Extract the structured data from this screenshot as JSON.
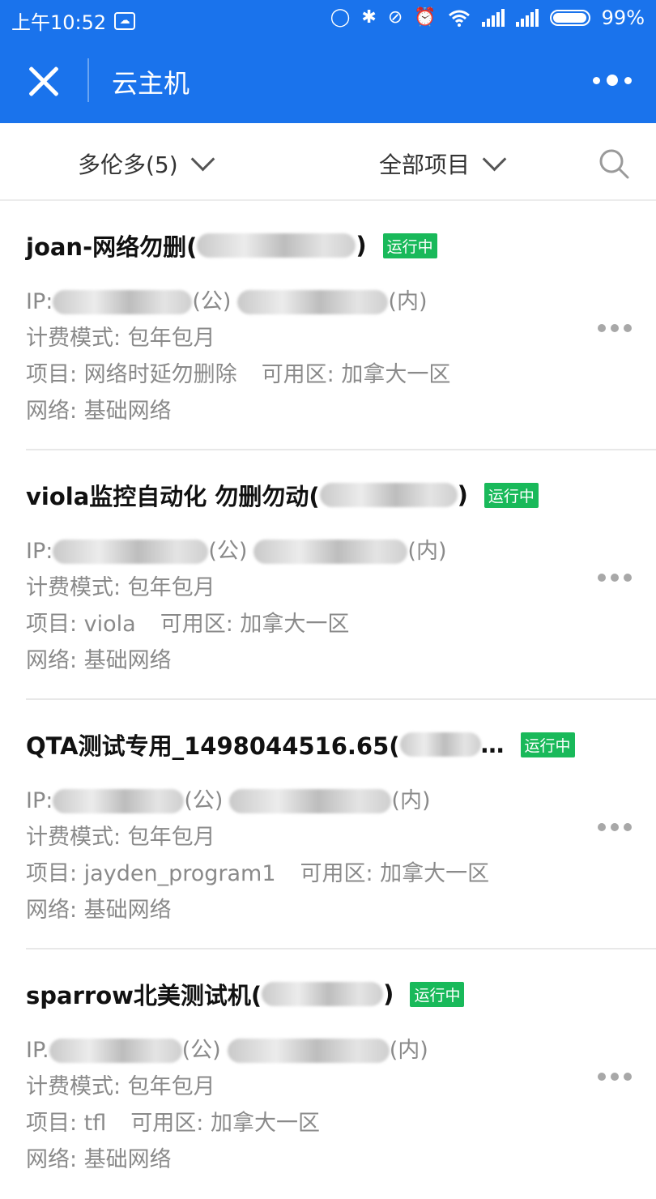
{
  "status_bar": {
    "time": "上午10:52",
    "battery_percent": "99%",
    "icons": [
      "cloud-icon",
      "sync-icon",
      "bluetooth-icon",
      "vibrate-off-icon",
      "alarm-icon",
      "wifi-icon",
      "signal-icon",
      "signal-icon",
      "battery-icon"
    ]
  },
  "app_bar": {
    "title": "云主机",
    "accent_color": "#1a73ec"
  },
  "filters": {
    "region": "多伦多(5)",
    "project": "全部项目"
  },
  "instances": [
    {
      "name": "joan-网络勿删(",
      "name_suffix": ")",
      "status": "运行中",
      "ip_label": "IP:",
      "public_tag": "(公)",
      "private_tag": "(内)",
      "billing": "计费模式: 包年包月",
      "project": "项目: 网络时延勿删除",
      "zone": "可用区: 加拿大一区",
      "network": "网络: 基础网络"
    },
    {
      "name": "viola监控自动化 勿删勿动(",
      "name_suffix": ")",
      "status": "运行中",
      "ip_label": "IP:",
      "public_tag": "(公)",
      "private_tag": "(内)",
      "billing": "计费模式: 包年包月",
      "project": "项目: viola",
      "zone": "可用区: 加拿大一区",
      "network": "网络: 基础网络"
    },
    {
      "name": "QTA测试专用_1498044516.65(",
      "name_suffix": "…",
      "status": "运行中",
      "ip_label": "IP:",
      "public_tag": "(公)",
      "private_tag": "(内)",
      "billing": "计费模式: 包年包月",
      "project": "项目: jayden_program1",
      "zone": "可用区: 加拿大一区",
      "network": "网络: 基础网络"
    },
    {
      "name": "sparrow北美测试机(",
      "name_suffix": ")",
      "status": "运行中",
      "ip_label": "IP.",
      "public_tag": "(公)",
      "private_tag": "(内)",
      "billing": "计费模式: 包年包月",
      "project": "项目: tfl",
      "zone": "可用区: 加拿大一区",
      "network": "网络: 基础网络"
    }
  ],
  "colors": {
    "status_badge": "#19b95a",
    "secondary_text": "#8a8a8a"
  }
}
